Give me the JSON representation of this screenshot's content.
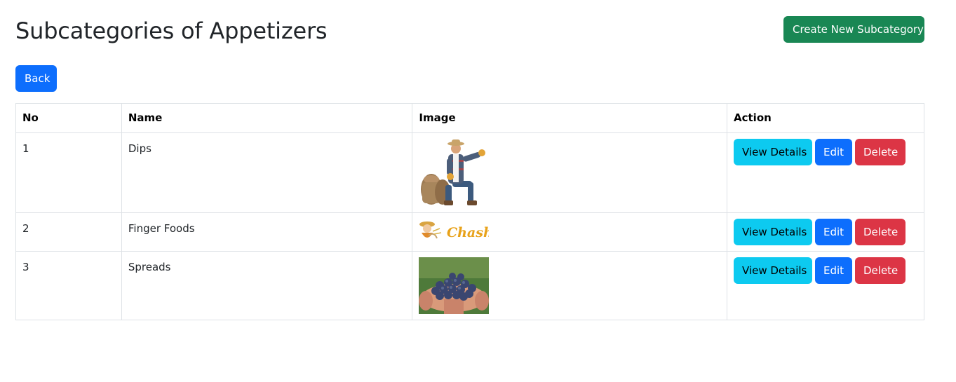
{
  "header": {
    "title": "Subcategories of Appetizers",
    "create_label": "Create New Subcategory",
    "back_label": "Back"
  },
  "table": {
    "columns": [
      "No",
      "Name",
      "Image",
      "Action"
    ],
    "rows": [
      {
        "no": "1",
        "name": "Dips",
        "image": "farmer-sitting-on-sacks-photo"
      },
      {
        "no": "2",
        "name": "Finger Foods",
        "image": "chashi-logo",
        "logo_text": "Chashi"
      },
      {
        "no": "3",
        "name": "Spreads",
        "image": "hands-holding-blueberries-photo"
      }
    ],
    "actions": {
      "view_label": "View Details",
      "edit_label": "Edit",
      "delete_label": "Delete"
    }
  },
  "colors": {
    "create": "#198754",
    "back": "#0d6efd",
    "view": "#0dcaf0",
    "edit": "#0d6efd",
    "delete": "#dc3545"
  }
}
